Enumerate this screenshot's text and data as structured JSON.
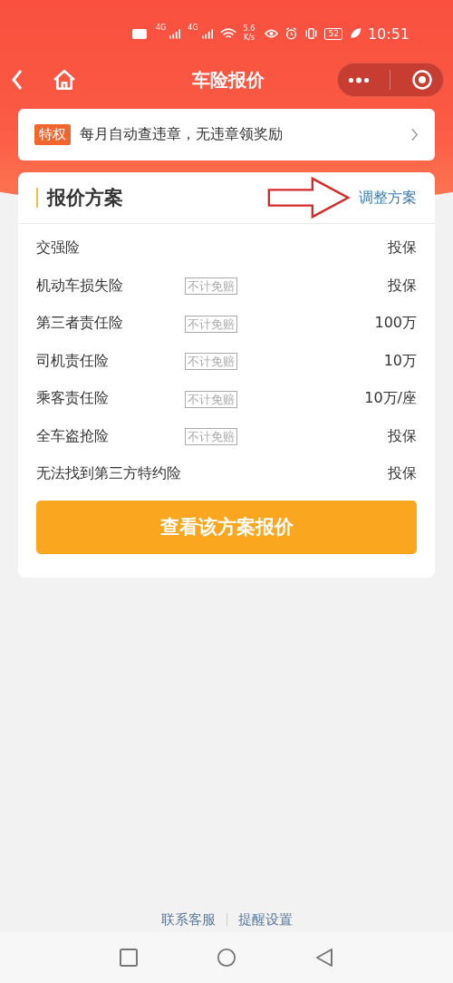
{
  "status_bar": {
    "network": [
      "4G",
      "4G"
    ],
    "speed": "5.6",
    "speed_unit": "K/s",
    "battery": "52",
    "time": "10:51"
  },
  "nav": {
    "title": "车险报价"
  },
  "banner": {
    "tag": "特权",
    "text": "每月自动查违章，无违章领奖励"
  },
  "plan": {
    "title": "报价方案",
    "action": "调整方案",
    "rows": [
      {
        "name": "交强险",
        "value": "投保"
      },
      {
        "name": "机动车损失险",
        "tag": "不计免赔",
        "value": "投保"
      },
      {
        "name": "第三者责任险",
        "tag": "不计免赔",
        "value": "100万"
      },
      {
        "name": "司机责任险",
        "tag": "不计免赔",
        "value": "10万"
      },
      {
        "name": "乘客责任险",
        "tag": "不计免赔",
        "value": "10万/座"
      },
      {
        "name": "全车盗抢险",
        "tag": "不计免赔",
        "value": "投保"
      },
      {
        "name": "无法找到第三方特约险",
        "value": "投保"
      }
    ],
    "button": "查看该方案报价"
  },
  "footer_links": [
    "联系客服",
    "提醒设置"
  ]
}
